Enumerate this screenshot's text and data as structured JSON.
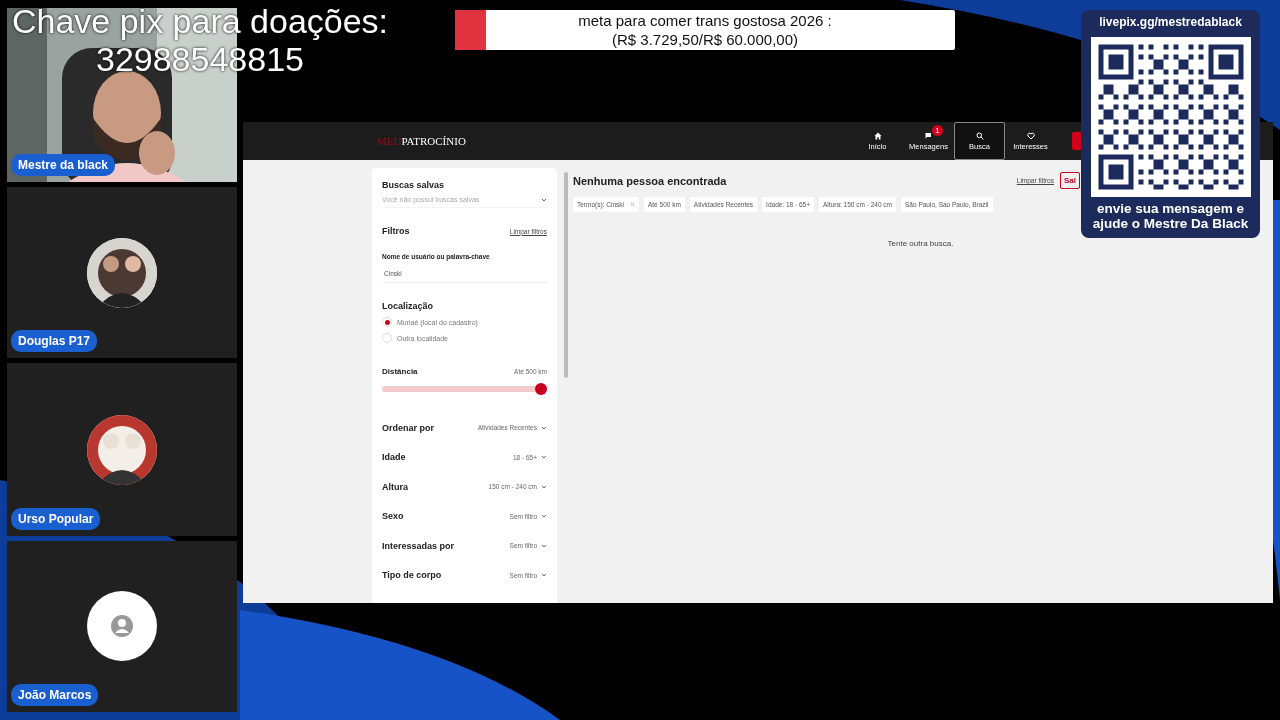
{
  "overlay": {
    "pix_title": "Chave pix para doações:",
    "pix_key": "32988548815"
  },
  "goal": {
    "line1": "meta para comer trans gostosa 2026 :",
    "line2": "(R$ 3.729,50/R$ 60.000,00)",
    "level": 0.062
  },
  "participants": [
    {
      "name": "Mestre da black",
      "kind": "camera"
    },
    {
      "name": "Douglas P17"
    },
    {
      "name": "Urso Popular"
    },
    {
      "name": "João Marcos",
      "kind": "placeholder"
    }
  ],
  "qr_card": {
    "url": "livepix.gg/mestredablack",
    "caption": [
      "envie sua mensagem e",
      "ajude o Mestre Da Black"
    ]
  },
  "site": {
    "logo": {
      "prefix": "MEU",
      "name": "PATROCÍNIO"
    },
    "nav": [
      {
        "label": "Início",
        "selected": false
      },
      {
        "label": "Mensagens",
        "selected": false,
        "badge": "1"
      },
      {
        "label": "Busca",
        "selected": true
      },
      {
        "label": "Interesses",
        "selected": false
      }
    ],
    "filters": {
      "saved_title": "Buscas salvas",
      "saved_placeholder": "Você não possui buscas salvas",
      "title": "Filtros",
      "clear": "Limpar filtros",
      "keyword": {
        "label": "Nome de usuário ou palavra-chave",
        "value": "Cinski"
      },
      "location": {
        "title": "Localização",
        "options": [
          {
            "label": "Muriaé (local do cadastro)",
            "selected": true
          },
          {
            "label": "Outra localidade",
            "selected": false
          }
        ]
      },
      "distance": {
        "label": "Distância",
        "reading": "Até 500 km",
        "level": 1
      },
      "selects": [
        {
          "label": "Ordenar por",
          "value": "Atividades Recentes"
        },
        {
          "label": "Idade",
          "value": "18 - 65+"
        },
        {
          "label": "Altura",
          "value": "150 cm - 240 cm"
        },
        {
          "label": "Sexo",
          "value": "Sem filtro"
        },
        {
          "label": "Interessadas por",
          "value": "Sem filtro"
        },
        {
          "label": "Tipo de corpo",
          "value": "Sem filtro"
        }
      ]
    },
    "results": {
      "title": "Nenhuma pessoa encontrada",
      "clear": "Limpar filtros",
      "save": "Sal",
      "chips": [
        {
          "label": "Termo(s): Cinski",
          "removable": true
        },
        {
          "label": "Até 500 km",
          "removable": false
        },
        {
          "label": "Atividades Recentes",
          "removable": false
        },
        {
          "label": "Idade: 18 - 65+",
          "removable": false
        },
        {
          "label": "Altura: 150 cm - 240 cm",
          "removable": false
        },
        {
          "label": "São Paulo, Sao Paulo, Brazil",
          "removable": false
        }
      ],
      "empty": "Tente outra busca."
    }
  }
}
